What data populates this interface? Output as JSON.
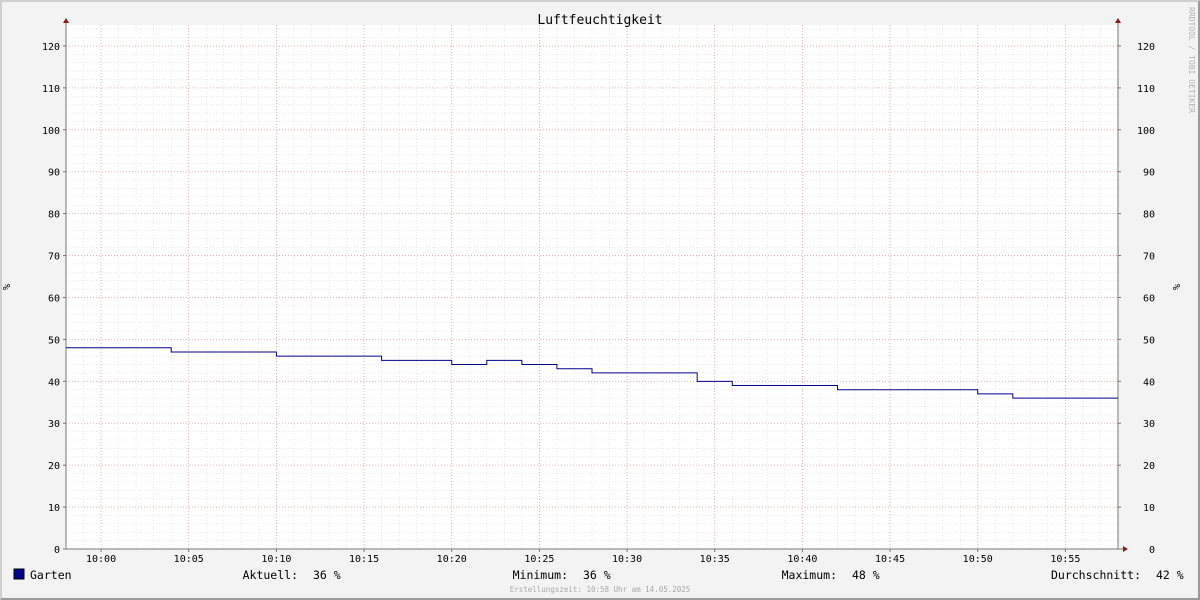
{
  "watermark": "RRDTOOL / TOBI OETIKER",
  "footer": {
    "timestamp": "Erstellungszeit: 10:58 Uhr am 14.05.2025",
    "legend_swatch_color": "#00008b"
  },
  "stats": {
    "current_label": "Aktuell:",
    "current_value": "36 %",
    "min_label": "Minimum:",
    "min_value": "36 %",
    "max_label": "Maximum:",
    "max_value": "48 %",
    "avg_label": "Durchschnitt:",
    "avg_value": "42 %"
  },
  "chart_data": {
    "type": "line",
    "title": "Luftfeuchtigkeit",
    "ylabel_left": "%",
    "ylabel_right": "%",
    "ylim": [
      0,
      125
    ],
    "y_ticks": [
      0,
      10,
      20,
      30,
      40,
      50,
      60,
      70,
      80,
      90,
      100,
      110,
      120
    ],
    "xlim": [
      "09:58",
      "10:58"
    ],
    "x_ticks": [
      "10:00",
      "10:05",
      "10:10",
      "10:15",
      "10:20",
      "10:25",
      "10:30",
      "10:35",
      "10:40",
      "10:45",
      "10:50",
      "10:55"
    ],
    "grid": true,
    "series": [
      {
        "name": "Garten",
        "color": "#00008b",
        "step": true,
        "points": [
          {
            "t": "09:58",
            "v": 48
          },
          {
            "t": "10:04",
            "v": 47
          },
          {
            "t": "10:10",
            "v": 46
          },
          {
            "t": "10:16",
            "v": 45
          },
          {
            "t": "10:20",
            "v": 44
          },
          {
            "t": "10:22",
            "v": 45
          },
          {
            "t": "10:24",
            "v": 44
          },
          {
            "t": "10:26",
            "v": 43
          },
          {
            "t": "10:28",
            "v": 42
          },
          {
            "t": "10:34",
            "v": 40
          },
          {
            "t": "10:36",
            "v": 39
          },
          {
            "t": "10:42",
            "v": 38
          },
          {
            "t": "10:50",
            "v": 37
          },
          {
            "t": "10:52",
            "v": 36
          },
          {
            "t": "10:58",
            "v": 36
          }
        ]
      }
    ]
  }
}
